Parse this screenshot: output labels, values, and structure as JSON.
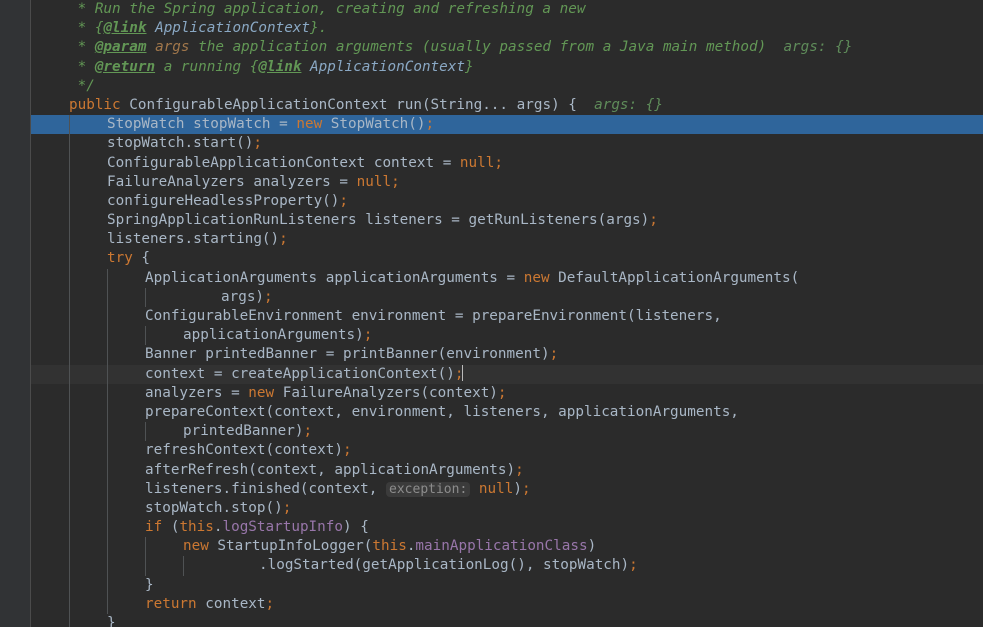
{
  "editor": {
    "language": "java",
    "theme": "darcula",
    "colors": {
      "background": "#2b2b2b",
      "gutter_background": "#313335",
      "selection": "#2f659b",
      "current_line": "#323232",
      "default_text": "#a9b7c6",
      "keyword": "#cc7832",
      "field": "#9876aa",
      "javadoc": "#629755",
      "javadoc_param": "#a1774b",
      "javadoc_link": "#8aa8c4",
      "inline_hint_value": "#5f8c5a",
      "param_hint_text": "#8c8c8c",
      "param_hint_background": "#3b3b3b",
      "indent_guide": "#4f5254",
      "gutter_separator": "#4b4b4b",
      "breakpoint_red": "#db5c5c",
      "fold_marker": "#808080"
    }
  },
  "gutter": {
    "annotation_marker": "@",
    "breakpoint_label": "verified-breakpoint",
    "fold_markers": [
      {
        "type": "javadoc-fold-collapse",
        "line": 4
      },
      {
        "type": "method-fold-collapse",
        "line": 5
      }
    ]
  },
  "inline_hints": {
    "args_param": "args: {}",
    "exception_param": "exception:"
  },
  "code_lines": [
    {
      "indent": 0,
      "selected": false,
      "current": false,
      "text": " * Run the Spring application, creating and refreshing a new"
    },
    {
      "indent": 0,
      "selected": false,
      "current": false,
      "text": " * {@link ApplicationContext}."
    },
    {
      "indent": 0,
      "selected": false,
      "current": false,
      "text": " * @param args the application arguments (usually passed from a Java main method)  args: {}"
    },
    {
      "indent": 0,
      "selected": false,
      "current": false,
      "text": " * @return a running {@link ApplicationContext}"
    },
    {
      "indent": 0,
      "selected": false,
      "current": false,
      "text": " */"
    },
    {
      "indent": 0,
      "selected": false,
      "current": false,
      "text": "public ConfigurableApplicationContext run(String... args) {  args: {}"
    },
    {
      "indent": 1,
      "selected": true,
      "current": false,
      "text": "StopWatch stopWatch = new StopWatch();"
    },
    {
      "indent": 1,
      "selected": false,
      "current": false,
      "text": "stopWatch.start();"
    },
    {
      "indent": 1,
      "selected": false,
      "current": false,
      "text": "ConfigurableApplicationContext context = null;"
    },
    {
      "indent": 1,
      "selected": false,
      "current": false,
      "text": "FailureAnalyzers analyzers = null;"
    },
    {
      "indent": 1,
      "selected": false,
      "current": false,
      "text": "configureHeadlessProperty();"
    },
    {
      "indent": 1,
      "selected": false,
      "current": false,
      "text": "SpringApplicationRunListeners listeners = getRunListeners(args);"
    },
    {
      "indent": 1,
      "selected": false,
      "current": false,
      "text": "listeners.starting();"
    },
    {
      "indent": 1,
      "selected": false,
      "current": false,
      "text": "try {"
    },
    {
      "indent": 2,
      "selected": false,
      "current": false,
      "text": "ApplicationArguments applicationArguments = new DefaultApplicationArguments("
    },
    {
      "indent": 3,
      "selected": false,
      "current": false,
      "text": "args);"
    },
    {
      "indent": 2,
      "selected": false,
      "current": false,
      "text": "ConfigurableEnvironment environment = prepareEnvironment(listeners,"
    },
    {
      "indent": 3,
      "selected": false,
      "current": false,
      "text": "applicationArguments);"
    },
    {
      "indent": 2,
      "selected": false,
      "current": false,
      "text": "Banner printedBanner = printBanner(environment);"
    },
    {
      "indent": 2,
      "selected": false,
      "current": true,
      "text": "context = createApplicationContext();"
    },
    {
      "indent": 2,
      "selected": false,
      "current": false,
      "text": "analyzers = new FailureAnalyzers(context);"
    },
    {
      "indent": 2,
      "selected": false,
      "current": false,
      "text": "prepareContext(context, environment, listeners, applicationArguments,"
    },
    {
      "indent": 3,
      "selected": false,
      "current": false,
      "text": "printedBanner);"
    },
    {
      "indent": 2,
      "selected": false,
      "current": false,
      "text": "refreshContext(context);"
    },
    {
      "indent": 2,
      "selected": false,
      "current": false,
      "text": "afterRefresh(context, applicationArguments);"
    },
    {
      "indent": 2,
      "selected": false,
      "current": false,
      "text": "listeners.finished(context,  exception: null);"
    },
    {
      "indent": 2,
      "selected": false,
      "current": false,
      "text": "stopWatch.stop();"
    },
    {
      "indent": 2,
      "selected": false,
      "current": false,
      "text": "if (this.logStartupInfo) {"
    },
    {
      "indent": 3,
      "selected": false,
      "current": false,
      "text": "new StartupInfoLogger(this.mainApplicationClass)"
    },
    {
      "indent": 4,
      "selected": false,
      "current": false,
      "text": ".logStarted(getApplicationLog(), stopWatch);"
    },
    {
      "indent": 2,
      "selected": false,
      "current": false,
      "text": "}"
    },
    {
      "indent": 2,
      "selected": false,
      "current": false,
      "text": "return context;"
    },
    {
      "indent": 1,
      "selected": false,
      "current": false,
      "text": "}"
    }
  ]
}
